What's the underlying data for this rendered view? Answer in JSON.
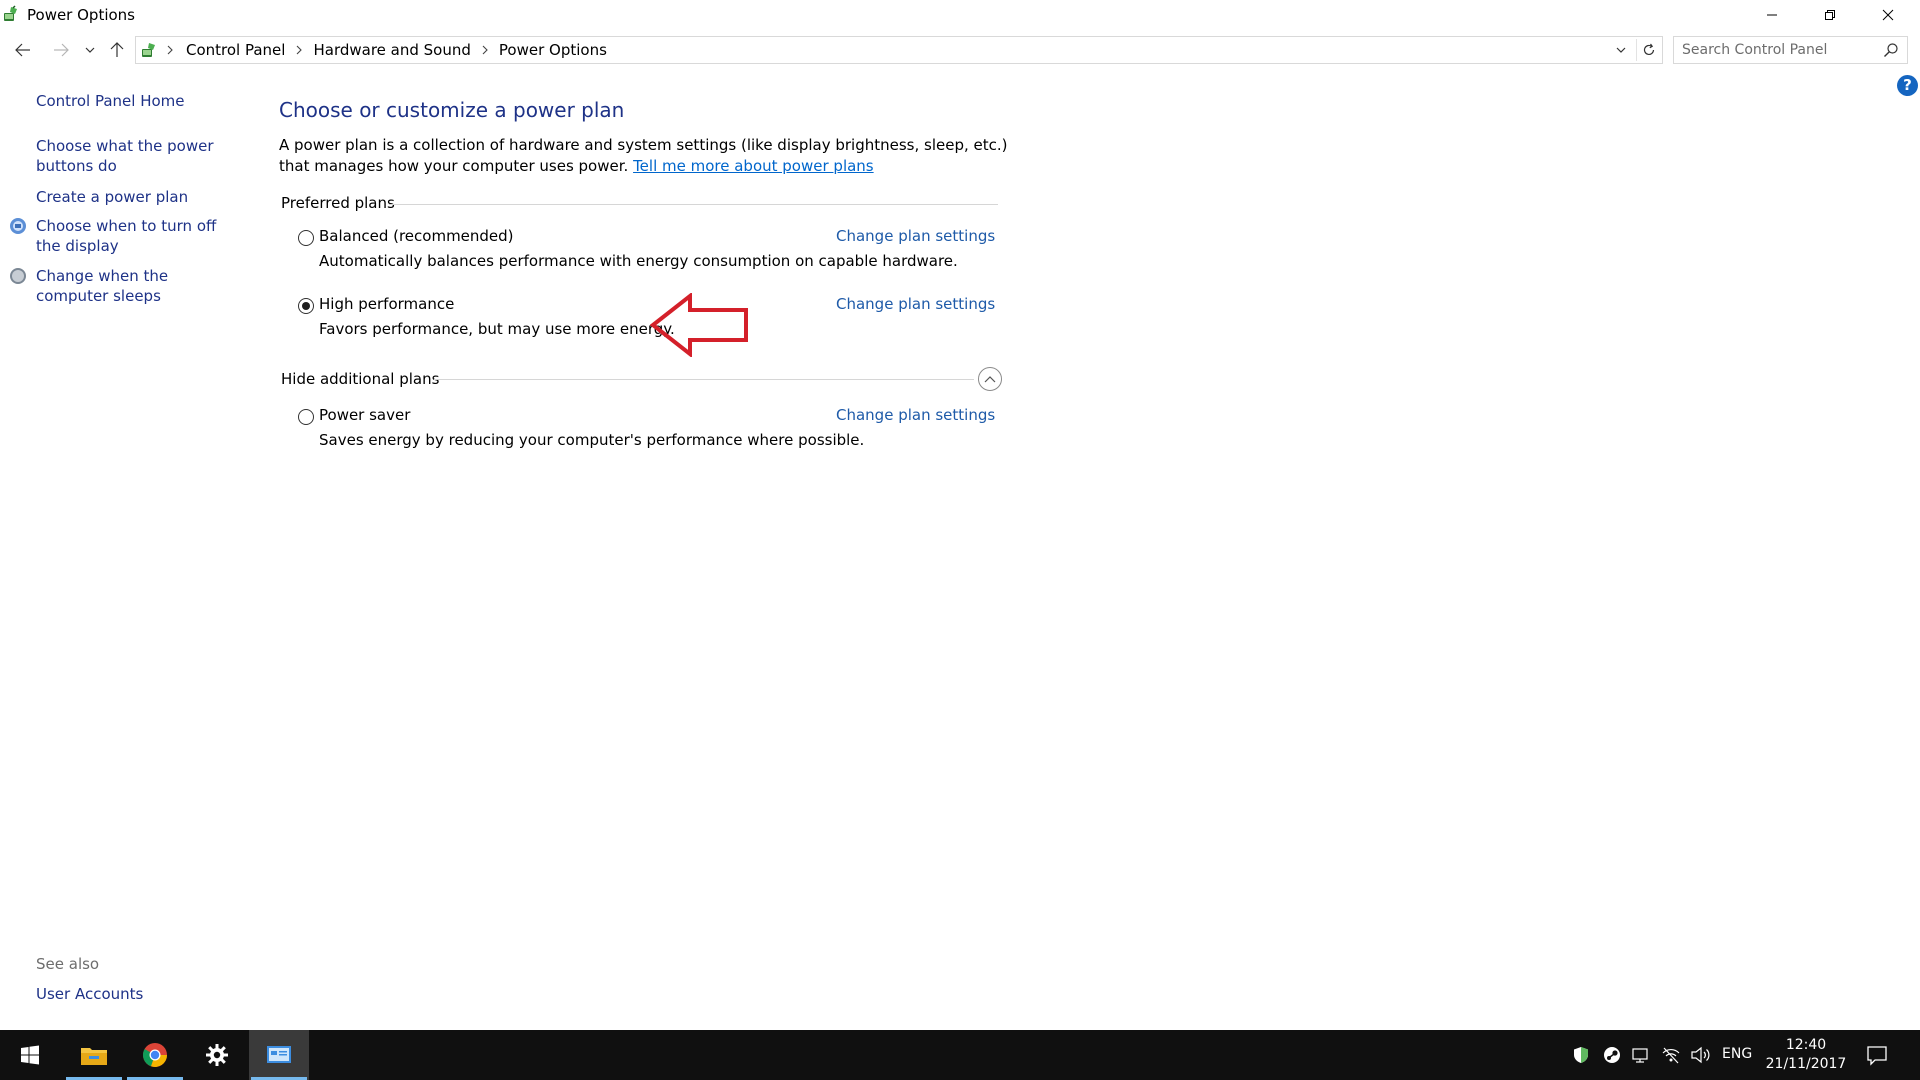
{
  "window": {
    "title": "Power Options"
  },
  "address": {
    "breadcrumbs": [
      "Control Panel",
      "Hardware and Sound",
      "Power Options"
    ],
    "search_placeholder": "Search Control Panel"
  },
  "help_label": "?",
  "sidebar": {
    "home": "Control Panel Home",
    "items": [
      {
        "label": "Choose what the power buttons do",
        "icon": "none"
      },
      {
        "label": "Create a power plan",
        "icon": "none"
      },
      {
        "label": "Choose when to turn off the display",
        "icon": "display-shield-icon"
      },
      {
        "label": "Change when the computer sleeps",
        "icon": "sleep-moon-icon"
      }
    ],
    "see_also": "See also",
    "see_also_links": [
      "User Accounts"
    ]
  },
  "main": {
    "title": "Choose or customize a power plan",
    "intro_text": "A power plan is a collection of hardware and system settings (like display brightness, sleep, etc.) that manages how your computer uses power.",
    "intro_link": "Tell me more about power plans",
    "preferred_header": "Preferred plans",
    "additional_header": "Hide additional plans",
    "change_label": "Change plan settings",
    "plans": [
      {
        "name": "Balanced (recommended)",
        "desc": "Automatically balances performance with energy consumption on capable hardware.",
        "selected": false
      },
      {
        "name": "High performance",
        "desc": "Favors performance, but may use more energy.",
        "selected": true
      },
      {
        "name": "Power saver",
        "desc": "Saves energy by reducing your computer's performance where possible.",
        "selected": false
      }
    ]
  },
  "annotation": {
    "arrow_color": "#d4202a"
  },
  "taskbar": {
    "apps": [
      "start-icon",
      "file-explorer-icon",
      "chrome-icon",
      "settings-gear-icon",
      "control-panel-icon"
    ],
    "language": "ENG",
    "time": "12:40",
    "date": "21/11/2017"
  },
  "colors": {
    "link": "#1e3287",
    "title_blue": "#1e3287",
    "accent": "#76b9ed",
    "taskbar": "#101010"
  }
}
